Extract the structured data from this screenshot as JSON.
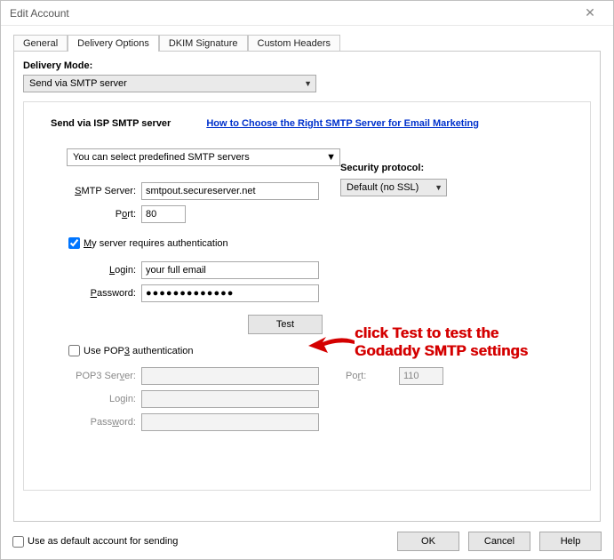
{
  "titlebar": {
    "title": "Edit Account"
  },
  "tabs": {
    "general": "General",
    "delivery": "Delivery Options",
    "dkim": "DKIM Signature",
    "custom": "Custom Headers"
  },
  "mode": {
    "label": "Delivery Mode:",
    "value": "Send via SMTP server"
  },
  "panel": {
    "heading": "Send via ISP SMTP server",
    "link": "How to Choose the Right SMTP Server for Email Marketing",
    "predefined": "You can select predefined SMTP servers",
    "security_label": "Security protocol:",
    "security_value": "Default (no SSL)",
    "smtp_label": "SMTP Server:",
    "smtp_value": "smtpout.secureserver.net",
    "port_label": "Port:",
    "port_value": "80",
    "auth_label": "My server requires authentication",
    "login_label": "Login:",
    "login_value": "your full email",
    "password_label": "Password:",
    "password_value": "●●●●●●●●●●●●●",
    "test_label": "Test",
    "pop3_check": "Use POP3 authentication",
    "pop3_server_label": "POP3 Server:",
    "pop3_server_value": "",
    "pop3_port_label": "Port:",
    "pop3_port_value": "110",
    "pop3_login_label": "Login:",
    "pop3_login_value": "",
    "pop3_password_label": "Password:",
    "pop3_password_value": ""
  },
  "annotation": "click Test to test the Godaddy SMTP settings",
  "footer": {
    "default_label": "Use as default account for sending",
    "ok": "OK",
    "cancel": "Cancel",
    "help": "Help"
  }
}
